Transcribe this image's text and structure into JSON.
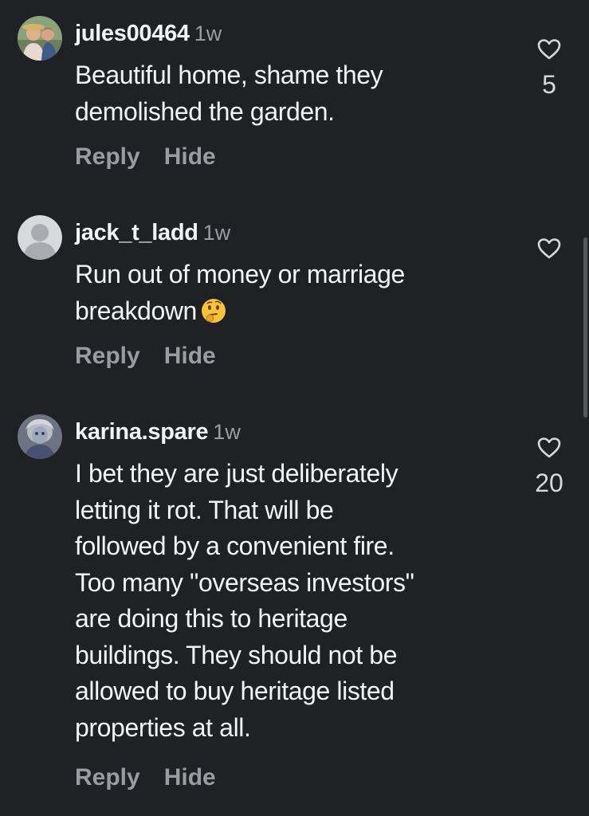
{
  "comments": [
    {
      "username": "jules00464",
      "time": "1w",
      "lines": [
        "Beautiful home, shame they",
        "demolished the garden."
      ],
      "reply_label": "Reply",
      "hide_label": "Hide",
      "like_count": "5",
      "avatar": "couple-photo"
    },
    {
      "username": "jack_t_ladd",
      "time": "1w",
      "lines": [
        "Run out of money or marriage",
        "breakdown"
      ],
      "emoji": "thinking-face",
      "reply_label": "Reply",
      "hide_label": "Hide",
      "like_count": "",
      "avatar": "default-person"
    },
    {
      "username": "karina.spare",
      "time": "1w",
      "lines": [
        "I bet they are just deliberately",
        "letting it rot. That will be",
        "followed by a convenient fire.",
        "Too many \"overseas investors\"",
        "are doing this to heritage",
        "buildings. They should not be",
        "allowed to buy heritage listed",
        "properties at all."
      ],
      "reply_label": "Reply",
      "hide_label": "Hide",
      "like_count": "20",
      "avatar": "portrait-photo"
    }
  ],
  "icons": {
    "like": "heart-outline-icon"
  }
}
